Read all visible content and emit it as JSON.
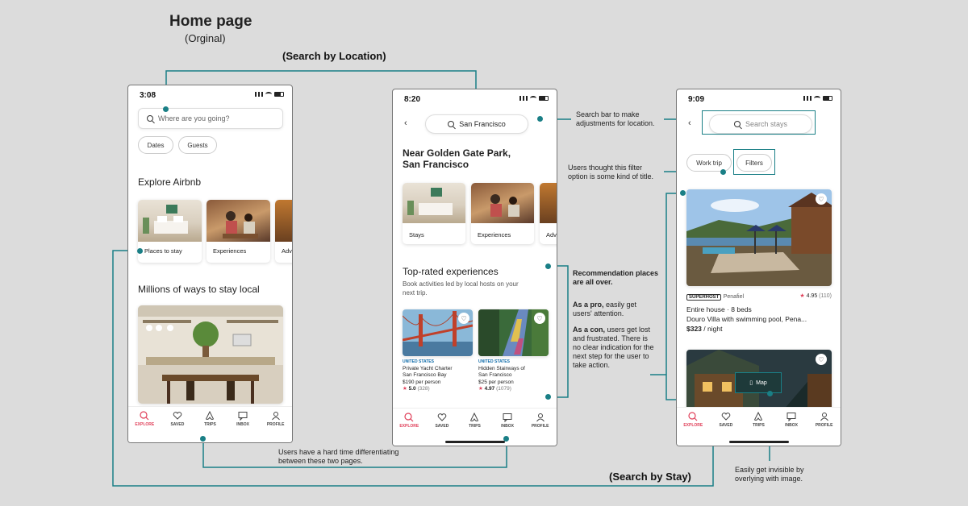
{
  "titles": {
    "main": "Home page",
    "sub": "(Orginal)",
    "search_location": "(Search by Location)",
    "search_stay": "(Search by Stay)"
  },
  "colors": {
    "annotation": "#1a7f86",
    "accent": "#e0405a"
  },
  "phone1": {
    "time": "3:08",
    "search_placeholder": "Where are you going?",
    "chips": [
      "Dates",
      "Guests"
    ],
    "explore_title": "Explore Airbnb",
    "cards": [
      "Places to stay",
      "Experiences",
      "Adv"
    ],
    "local_title": "Millions of ways to stay local"
  },
  "phone2": {
    "time": "8:20",
    "search_value": "San Francisco",
    "heading_line1": "Near Golden Gate Park,",
    "heading_line2": "San Francisco",
    "cards": [
      "Stays",
      "Experiences",
      "Adv"
    ],
    "top_title": "Top-rated experiences",
    "top_sub_line1": "Book activities led by local hosts on your",
    "top_sub_line2": "next trip.",
    "experiences": [
      {
        "category": "UNITED STATES",
        "title_line1": "Private Yacht Charter",
        "title_line2": "San Francisco Bay",
        "price": "$190 per person",
        "rating": "5.0",
        "count": "(328)"
      },
      {
        "category": "UNITED STATES",
        "title_line1": "Hidden Stairways of",
        "title_line2": "San Francisco",
        "price": "$25 per person",
        "rating": "4.97",
        "count": "(1079)"
      }
    ]
  },
  "phone3": {
    "time": "9:09",
    "search_placeholder": "Search stays",
    "chips": [
      "Work trip",
      "Filters"
    ],
    "badge": "SUPERHOST",
    "location": "Penafiel",
    "rating": "4.95",
    "count": "(110)",
    "line1": "Entire house · 8 beds",
    "line2": "Douro Villa with swimming pool, Pena...",
    "price": "$323",
    "price_unit": " / night",
    "map_label": "Map"
  },
  "tabs": [
    "EXPLORE",
    "SAVED",
    "TRIPS",
    "INBOX",
    "PROFILE"
  ],
  "notes": {
    "search_bar_line1": "Search bar to make",
    "search_bar_line2": "adjustments for location.",
    "filter_line1": "Users thought this filter",
    "filter_line2": "option is some kind of title.",
    "rec_line1": "Recommendation places",
    "rec_line2": "are all over.",
    "pro_bold": "As a pro,",
    "pro_rest": " easily get",
    "pro_line2": "users' attention.",
    "con_bold": "As a con,",
    "con_rest": " users get lost",
    "con_line2": "and frustrated. There is",
    "con_line3": "no clear indication for the",
    "con_line4": "next step for the user to",
    "con_line5": "take action.",
    "diff_line1": "Users have a hard time differentiating",
    "diff_line2": "between these two pages.",
    "invisible_line1": "Easily get invisible by",
    "invisible_line2": "overlying with image."
  }
}
